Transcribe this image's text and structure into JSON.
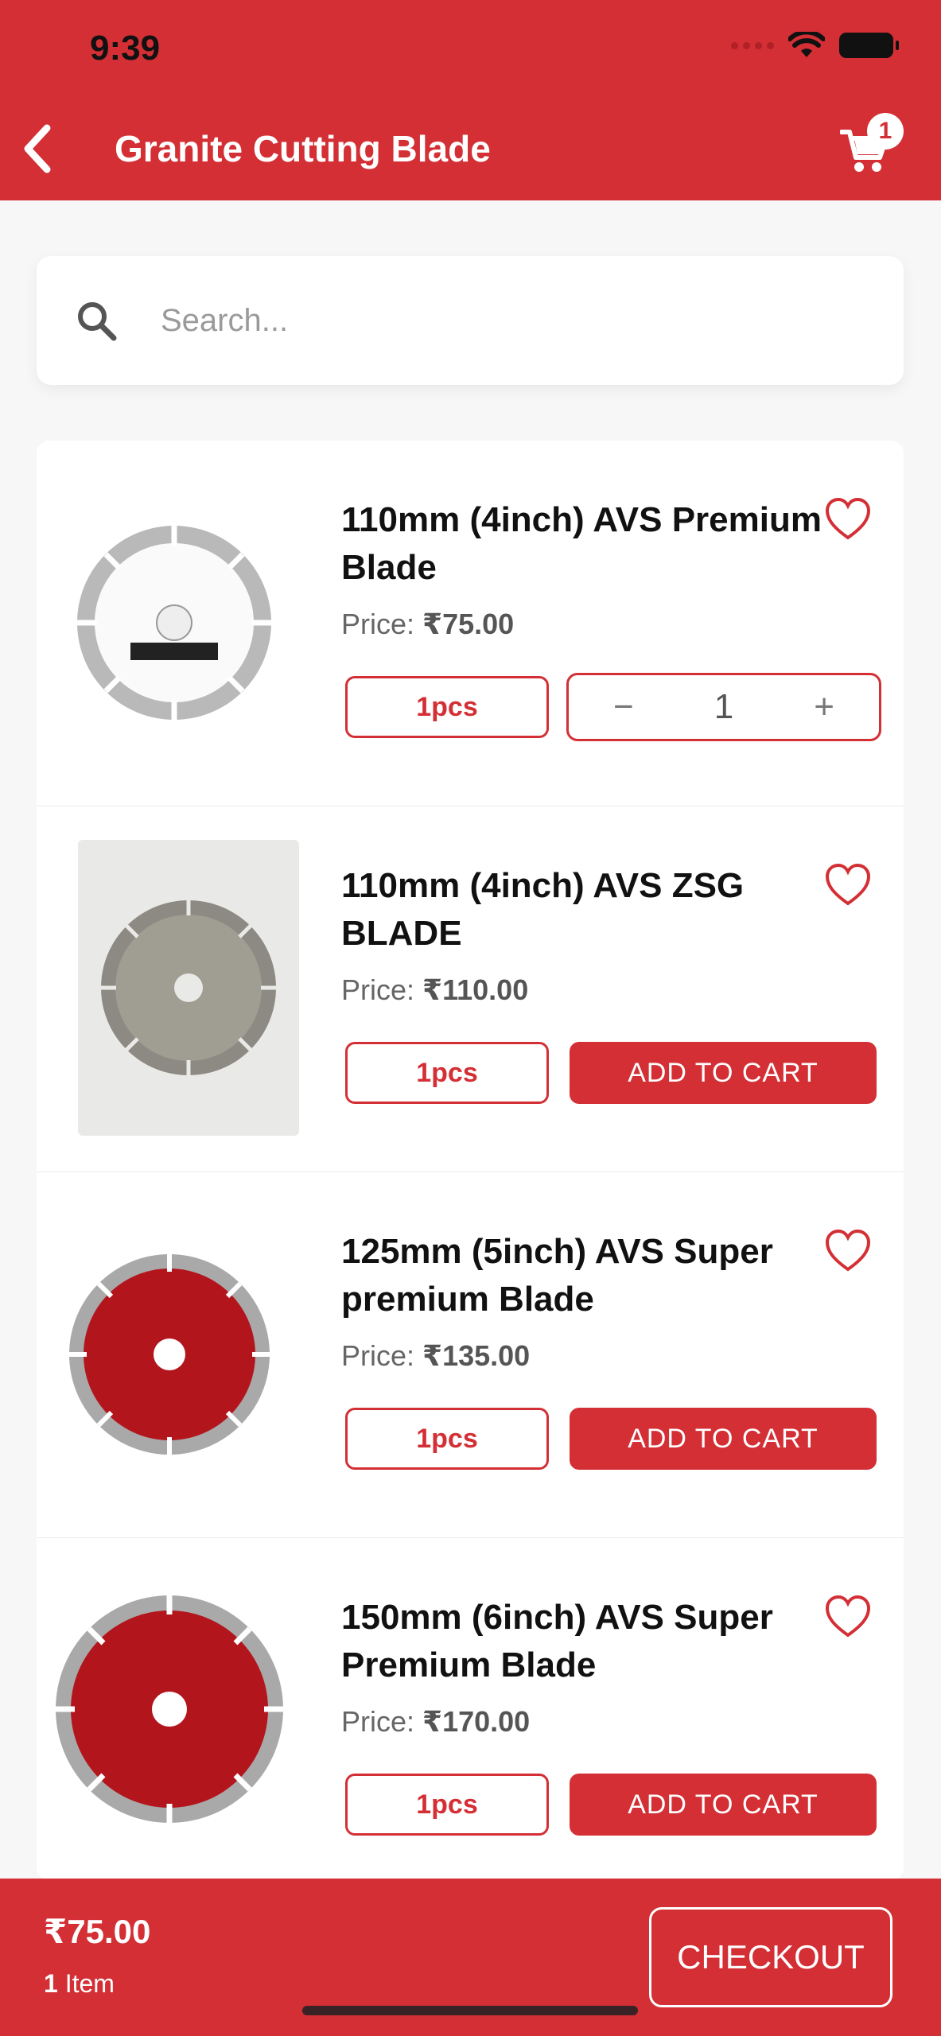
{
  "status_bar": {
    "time": "9:39"
  },
  "header": {
    "title": "Granite Cutting Blade",
    "cart_count": "1"
  },
  "search": {
    "placeholder": "Search..."
  },
  "products": [
    {
      "name": "110mm (4inch) AVS Premium Blade",
      "price_label": "Price:",
      "price": "₹75.00",
      "unit": "1pcs",
      "in_cart": true,
      "quantity": "1",
      "image_icon": "white-blade-image"
    },
    {
      "name": "110mm (4inch) AVS ZSG BLADE",
      "price_label": "Price:",
      "price": "₹110.00",
      "unit": "1pcs",
      "in_cart": false,
      "add_label": "ADD TO CART",
      "image_icon": "grey-blade-photo"
    },
    {
      "name": "125mm (5inch) AVS Super premium Blade",
      "price_label": "Price:",
      "price": "₹135.00",
      "unit": "1pcs",
      "in_cart": false,
      "add_label": "ADD TO CART",
      "image_icon": "red-blade-image"
    },
    {
      "name": "150mm (6inch) AVS Super Premium Blade",
      "price_label": "Price:",
      "price": "₹170.00",
      "unit": "1pcs",
      "in_cart": false,
      "add_label": "ADD TO CART",
      "image_icon": "red-blade-image"
    }
  ],
  "stepper": {
    "minus": "−",
    "plus": "+"
  },
  "footer": {
    "total": "₹75.00",
    "item_count": "1",
    "item_word": "Item",
    "checkout_label": "CHECKOUT"
  },
  "colors": {
    "accent": "#d32f35",
    "background": "#f7f7f7"
  }
}
